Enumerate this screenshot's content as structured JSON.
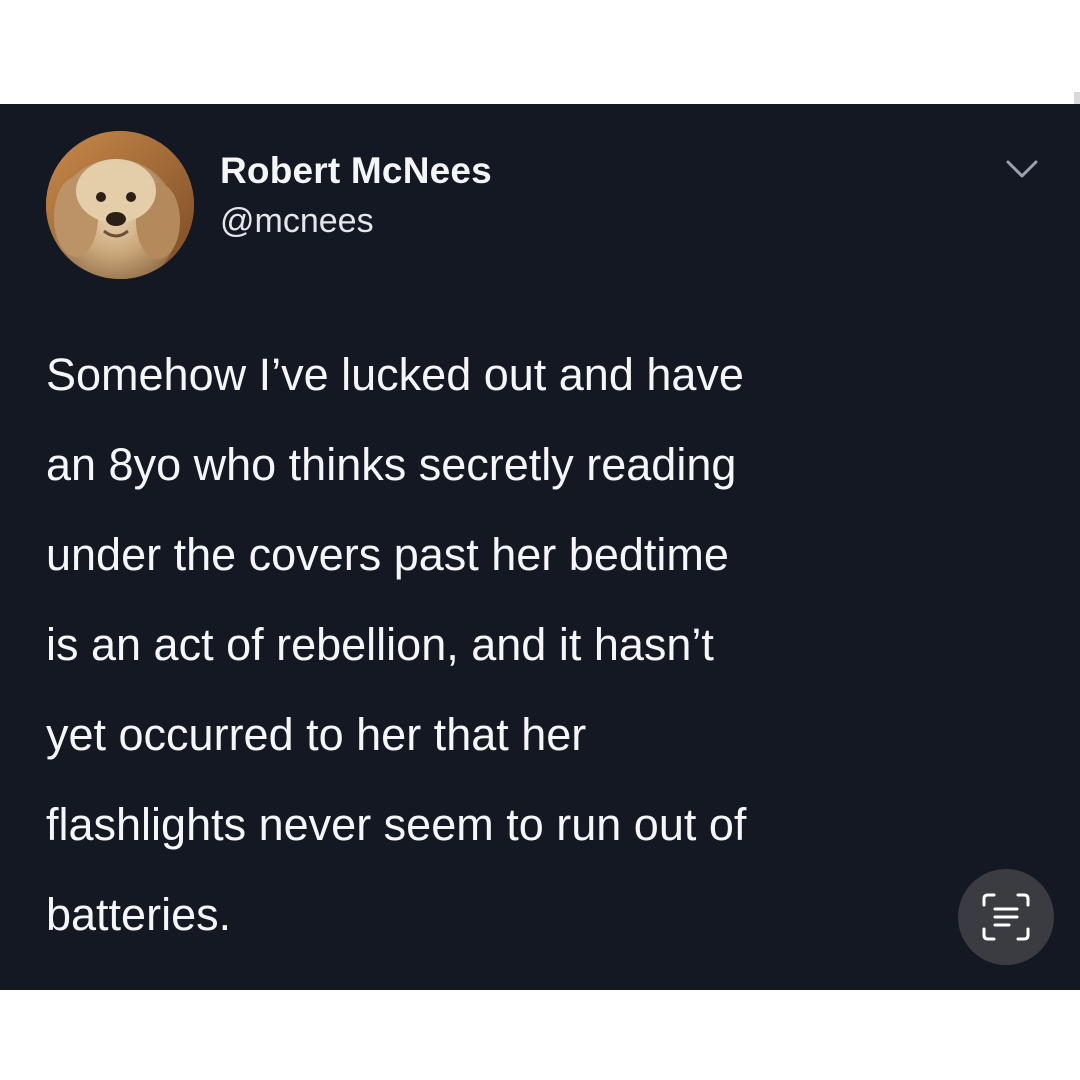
{
  "author": {
    "name": "Robert McNees",
    "handle": "@mcnees"
  },
  "tweet": {
    "lines": [
      "Somehow I’ve lucked out and have",
      "an 8yo who thinks secretly reading",
      "under the covers past her bedtime",
      "is an act of rebellion, and it hasn’t",
      "yet occurred to her that her",
      "flashlights never seem to run out of",
      "batteries."
    ]
  },
  "icons": {
    "avatar": "dog-avatar",
    "menu": "chevron-down-icon",
    "scan": "text-scan-icon"
  },
  "colors": {
    "background": "#141823",
    "text": "#f5f6f8",
    "page": "#ffffff",
    "scan_button": "#3a3c41"
  }
}
